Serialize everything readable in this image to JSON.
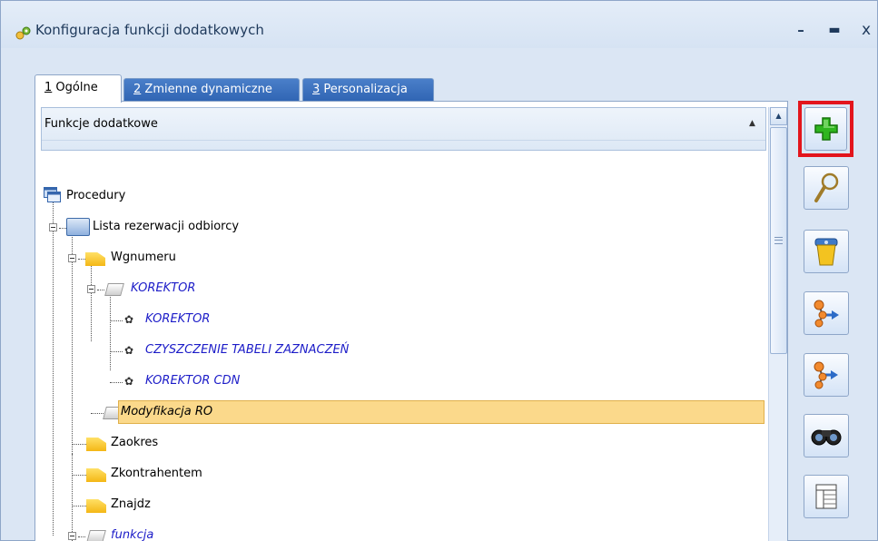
{
  "window": {
    "title": "Konfiguracja funkcji dodatkowych",
    "min_glyph": "–",
    "max_glyph": "▬",
    "close_glyph": "x"
  },
  "tabs": [
    {
      "num": "1",
      "label": " Ogólne",
      "active": true
    },
    {
      "num": "2",
      "label": " Zmienne dynamiczne",
      "active": false
    },
    {
      "num": "3",
      "label": " Personalizacja",
      "active": false
    }
  ],
  "list": {
    "header": "Funkcje dodatkowe",
    "sort_glyph": "▲"
  },
  "tree": [
    {
      "label": "Procedury",
      "icon": "windows-icon",
      "italic": false
    },
    {
      "label": "Lista rezerwacji odbiorcy",
      "icon": "screen-icon",
      "italic": false
    },
    {
      "label": "Wgnumeru",
      "icon": "folder-icon",
      "italic": false
    },
    {
      "label": "KOREKTOR",
      "icon": "sheet-icon",
      "italic": true
    },
    {
      "label": "KOREKTOR",
      "icon": "gear-icon",
      "italic": true
    },
    {
      "label": "CZYSZCZENIE TABELI ZAZNACZEŃ",
      "icon": "gear-icon",
      "italic": true
    },
    {
      "label": "KOREKTOR CDN",
      "icon": "gear-icon",
      "italic": true
    },
    {
      "label": "Modyfikacja RO",
      "icon": "sheet-icon",
      "italic": true,
      "selected": true
    },
    {
      "label": "Zaokres",
      "icon": "folder-icon",
      "italic": false
    },
    {
      "label": "Zkontrahentem",
      "icon": "folder-icon",
      "italic": false
    },
    {
      "label": "Znajdz",
      "icon": "folder-icon",
      "italic": false
    },
    {
      "label": "funkcja",
      "icon": "sheet-icon",
      "italic": true
    }
  ],
  "toolbar": {
    "buttons": [
      {
        "name": "add-button",
        "icon": "plus-icon"
      },
      {
        "name": "preview-button",
        "icon": "magnifier-icon"
      },
      {
        "name": "delete-button",
        "icon": "trash-icon"
      },
      {
        "name": "export-button",
        "icon": "molecule-export-icon"
      },
      {
        "name": "import-button",
        "icon": "molecule-import-icon"
      },
      {
        "name": "find-button",
        "icon": "binoculars-icon"
      },
      {
        "name": "columns-button",
        "icon": "table-icon"
      }
    ]
  },
  "colors": {
    "selection": "#fbd98b",
    "highlight_frame": "#e3151c",
    "italic_text": "#1c1cc8",
    "tab_inactive": "#2f64b3"
  }
}
